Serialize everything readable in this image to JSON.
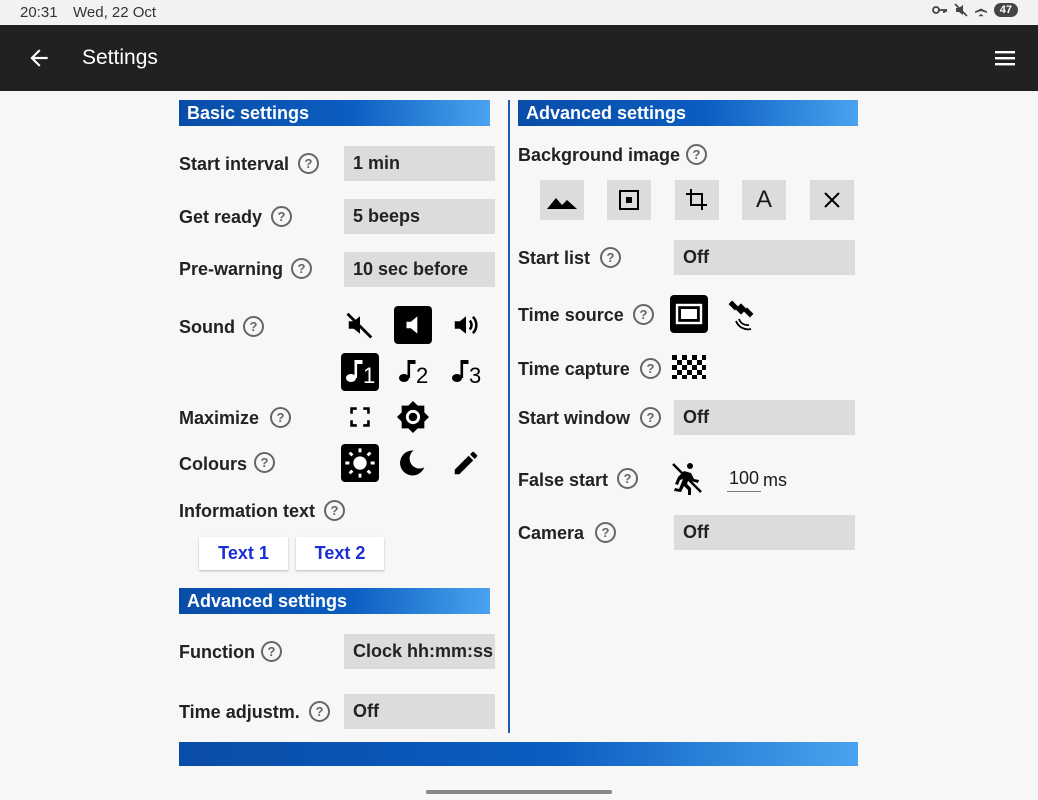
{
  "status": {
    "time": "20:31",
    "date": "Wed, 22 Oct",
    "battery": "47"
  },
  "appbar": {
    "title": "Settings"
  },
  "basic": {
    "header": "Basic settings",
    "start_interval": {
      "label": "Start interval",
      "value": "1 min"
    },
    "get_ready": {
      "label": "Get ready",
      "value": "5 beeps"
    },
    "pre_warning": {
      "label": "Pre-warning",
      "value": "10 sec before"
    },
    "sound": {
      "label": "Sound",
      "tune_labels": [
        "1",
        "2",
        "3"
      ]
    },
    "maximize": {
      "label": "Maximize"
    },
    "colours": {
      "label": "Colours"
    },
    "information_text": {
      "label": "Information text",
      "buttons": [
        "Text 1",
        "Text 2"
      ]
    }
  },
  "advanced_left": {
    "header": "Advanced settings",
    "function": {
      "label": "Function",
      "value": "Clock hh:mm:ss"
    },
    "time_adjustment": {
      "label": "Time adjustm.",
      "value": "Off"
    }
  },
  "advanced_right": {
    "header": "Advanced settings",
    "background_image": {
      "label": "Background image",
      "text_button": "A"
    },
    "start_list": {
      "label": "Start list",
      "value": "Off"
    },
    "time_source": {
      "label": "Time source"
    },
    "time_capture": {
      "label": "Time capture"
    },
    "start_window": {
      "label": "Start window",
      "value": "Off"
    },
    "false_start": {
      "label": "False start",
      "value": "100",
      "unit": "ms"
    },
    "camera": {
      "label": "Camera",
      "value": "Off"
    }
  },
  "help_glyph": "?",
  "colors": {
    "appbar": "#212121",
    "accent": "#0b5dc0",
    "link": "#1a2fd6",
    "field": "#dcdcdc"
  }
}
